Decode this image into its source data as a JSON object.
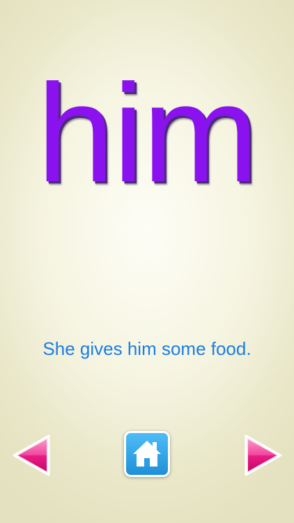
{
  "card": {
    "word": "him",
    "sentence": "She gives him some food."
  },
  "controls": {
    "previous_icon": "left-arrow-icon",
    "home_icon": "house-icon",
    "next_icon": "right-arrow-icon"
  },
  "colors": {
    "word": "#8a12ef",
    "sentence": "#1a7ee6",
    "arrows": "#e8147e",
    "home_button": "#2ba5ea"
  }
}
